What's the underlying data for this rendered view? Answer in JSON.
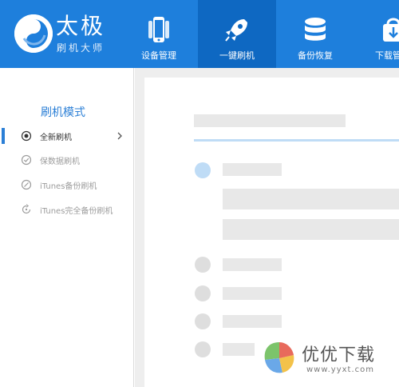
{
  "brand": {
    "name": "太极",
    "subtitle": "刷机大师"
  },
  "nav": {
    "tabs": [
      {
        "label": "设备管理",
        "icon": "phone-icon",
        "active": false
      },
      {
        "label": "一键刷机",
        "icon": "rocket-icon",
        "active": true
      },
      {
        "label": "备份恢复",
        "icon": "database-icon",
        "active": false
      },
      {
        "label": "下载管",
        "icon": "download-bag-icon",
        "active": false
      }
    ]
  },
  "sidebar": {
    "title": "刷机模式",
    "items": [
      {
        "label": "全新刷机",
        "icon": "radio-dot-icon",
        "active": true
      },
      {
        "label": "保数据刷机",
        "icon": "check-circle-icon",
        "active": false
      },
      {
        "label": "iTunes备份刷机",
        "icon": "slash-circle-icon",
        "active": false
      },
      {
        "label": "iTunes完全备份刷机",
        "icon": "refresh-circle-icon",
        "active": false
      }
    ]
  },
  "watermark": {
    "title": "优优下载",
    "url": "www.yyxt.com"
  },
  "colors": {
    "topbar": "#1e7fdc",
    "topbar_active": "#0e68c2",
    "accent": "#2b7fd6",
    "placeholder": "#e8e8e8",
    "placeholder_blue": "#bfdcf6"
  }
}
